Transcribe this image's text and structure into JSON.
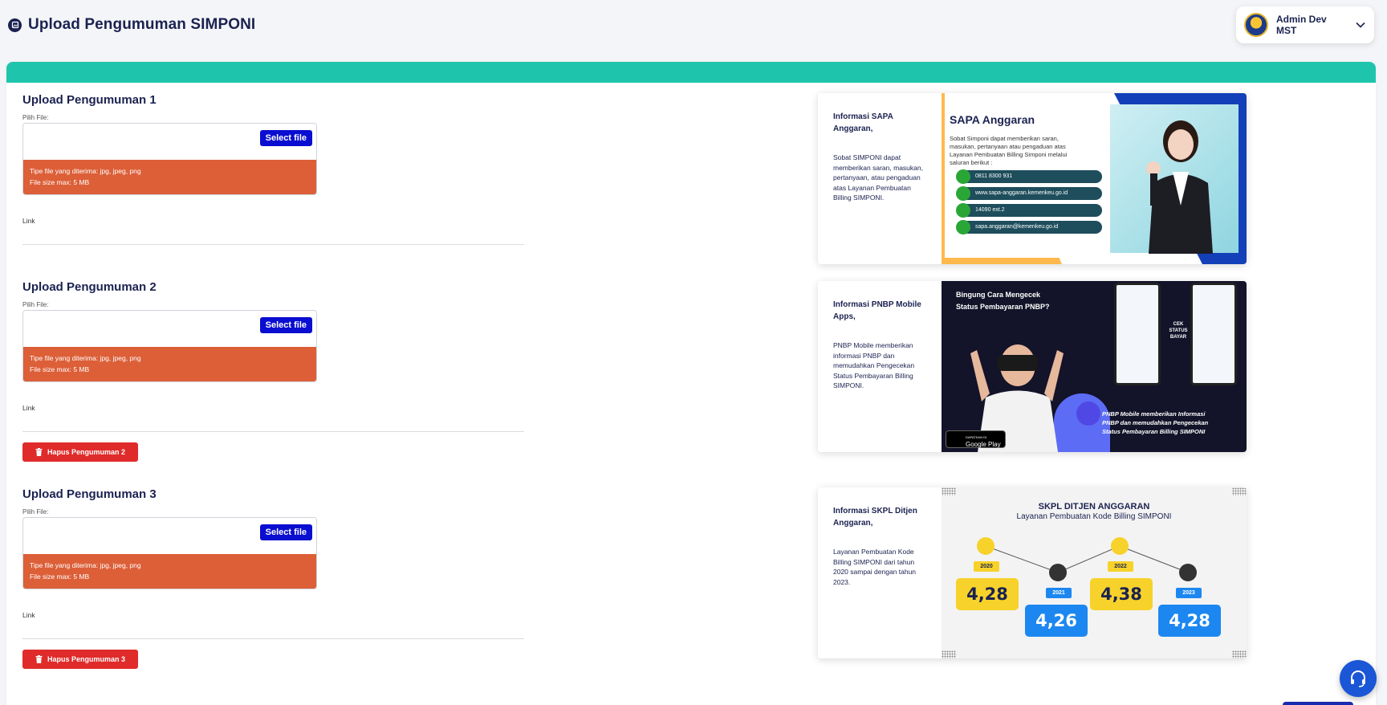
{
  "header": {
    "title": "Upload Pengumuman SIMPONI",
    "user_name": "Admin Dev MST"
  },
  "uploads": [
    {
      "title": "Upload Pengumuman 1",
      "file_label": "Pilih File:",
      "select_label": "Select file",
      "file_types": "Tipe file yang diterima: jpg, jpeg, png",
      "file_size": "File size max: 5 MB",
      "link_label": "Link"
    },
    {
      "title": "Upload Pengumuman 2",
      "file_label": "Pilih File:",
      "select_label": "Select file",
      "file_types": "Tipe file yang diterima: jpg, jpeg, png",
      "file_size": "File size max: 5 MB",
      "link_label": "Link",
      "delete_label": "Hapus Pengumuman 2"
    },
    {
      "title": "Upload Pengumuman 3",
      "file_label": "Pilih File:",
      "select_label": "Select file",
      "file_types": "Tipe file yang diterima: jpg, jpeg, png",
      "file_size": "File size max: 5 MB",
      "link_label": "Link",
      "delete_label": "Hapus Pengumuman 3"
    }
  ],
  "previews": [
    {
      "title": "Informasi SAPA Anggaran,",
      "description": "Sobat SIMPONI dapat memberikan saran, masukan, pertanyaan, atau pengaduan atas Layanan Pembuatan Billing SIMPONI.",
      "banner": {
        "heading": "SAPA Anggaran",
        "sub": "Sobat Simponi dapat memberikan saran, masukan, pertanyaan atau pengaduan atas Layanan Pembuatan Billing Simponi melalui saluran berikut :",
        "contacts": [
          "0811 8300 931",
          "www.sapa-anggaran.kemenkeu.go.id",
          "14090 ext.2",
          "sapa.anggaran@kemenkeu.go.id"
        ]
      }
    },
    {
      "title": "Informasi PNBP Mobile Apps,",
      "description": "PNBP Mobile memberikan informasi PNBP dan memudahkan Pengecekan Status Pembayaran Billing SIMPONI.",
      "banner": {
        "heading": "Bingung Cara Mengecek Status Pembayaran PNBP?",
        "arrow_label": "CEK STATUS BAYAR",
        "quote": "PNBP Mobile memberikan Informasi PNBP dan memudahkan Pengecekan Status Pembayaran Billing SIMPONI",
        "store_small": "DAPATKAN DI",
        "store_name": "Google Play"
      }
    },
    {
      "title": "Informasi SKPL Ditjen Anggaran,",
      "description": "Layanan Pembuatan Kode Billing SIMPONI dari tahun 2020 sampai dengan tahun 2023.",
      "banner": {
        "heading": "SKPL DITJEN ANGGARAN",
        "sub": "Layanan Pembuatan Kode Billing SIMPONI",
        "years": [
          "2020",
          "2021",
          "2022",
          "2023"
        ],
        "values": [
          "4,28",
          "4,26",
          "4,38",
          "4,28"
        ]
      }
    }
  ],
  "colors": {
    "accent_teal": "#1ec5ac",
    "select_blue": "#0a0ed0",
    "info_orange": "#dc5f38",
    "danger_red": "#e02b2b"
  }
}
